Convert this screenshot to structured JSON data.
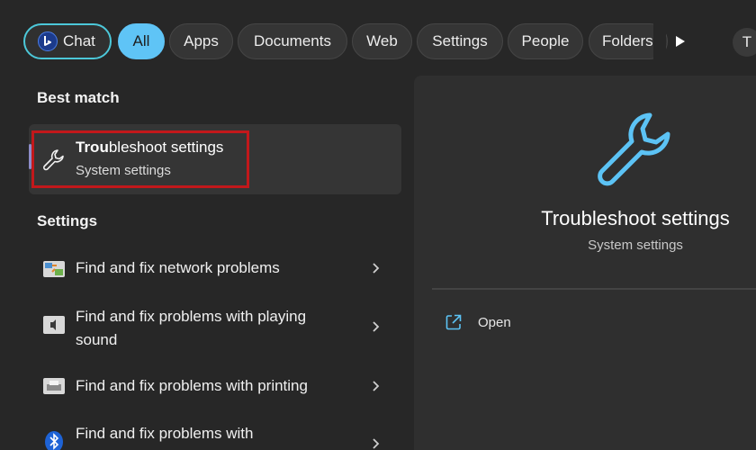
{
  "filters": {
    "chat": "Chat",
    "all": "All",
    "apps": "Apps",
    "documents": "Documents",
    "web": "Web",
    "settings": "Settings",
    "people": "People",
    "folders": "Folders"
  },
  "avatar_initial": "T",
  "sections": {
    "best_match": "Best match",
    "settings": "Settings"
  },
  "best_match": {
    "title_bold": "Trou",
    "title_rest": "bleshoot settings",
    "subtitle": "System settings",
    "icon": "wrench-icon"
  },
  "settings_results": [
    {
      "line1": "Find and fix network problems",
      "line2": "",
      "icon": "network-troubleshooter-icon"
    },
    {
      "line1": "Find and fix problems with playing",
      "line2": "sound",
      "icon": "sound-troubleshooter-icon"
    },
    {
      "line1": "Find and fix problems with printing",
      "line2": "",
      "icon": "printer-icon"
    },
    {
      "line1": "Find and fix problems with",
      "line2": "",
      "icon": "bluetooth-icon"
    }
  ],
  "preview": {
    "title": "Troubleshoot settings",
    "subtitle": "System settings",
    "open_label": "Open"
  },
  "colors": {
    "accent": "#5fc4f6",
    "chat_border": "#4cc8d9",
    "highlight": "#c2181b",
    "background": "#272727"
  }
}
